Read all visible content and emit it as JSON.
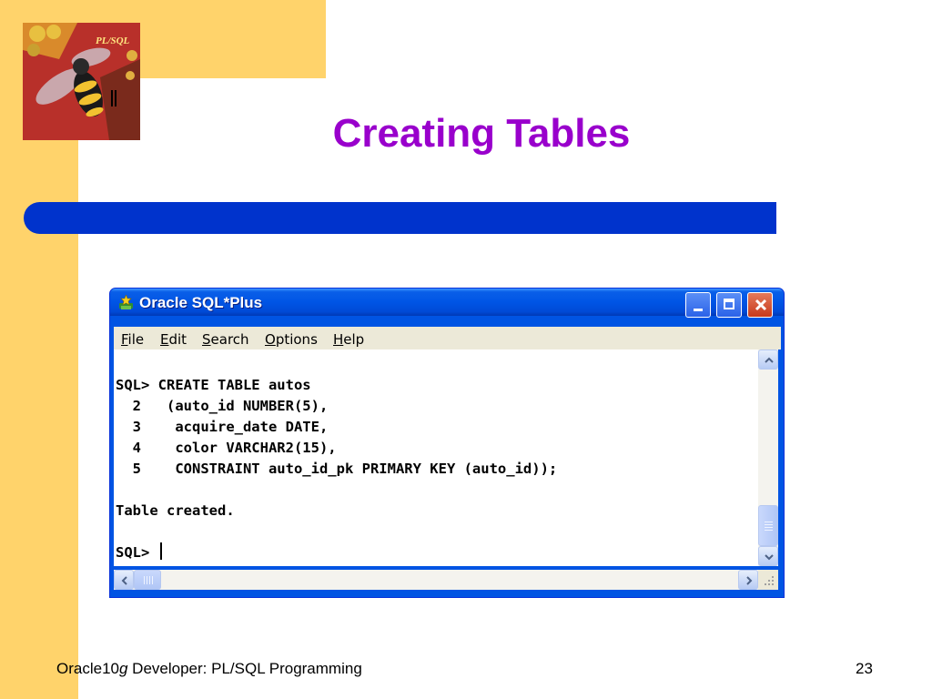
{
  "slide": {
    "title": "Creating Tables",
    "logo_text": "PL/SQL",
    "footer": {
      "product": "Oracle10",
      "product_suffix": "g",
      "rest": " Developer: PL/SQL Programming",
      "page_number": "23"
    }
  },
  "window": {
    "title": "Oracle SQL*Plus",
    "controls": [
      "minimize",
      "maximize",
      "close"
    ],
    "menu": [
      "File",
      "Edit",
      "Search",
      "Options",
      "Help"
    ],
    "console_lines": [
      "SQL> CREATE TABLE autos",
      "  2   (auto_id NUMBER(5),",
      "  3    acquire_date DATE,",
      "  4    color VARCHAR2(15),",
      "  5    CONSTRAINT auto_id_pk PRIMARY KEY (auto_id));",
      "",
      "Table created.",
      ""
    ],
    "prompt": "SQL> ",
    "scroll_position": 1.0
  },
  "icons": {
    "app": "oracle-sqlplus-icon",
    "scroll_up": "chevron-up-icon",
    "scroll_down": "chevron-down-icon",
    "scroll_left": "chevron-left-icon",
    "scroll_right": "chevron-right-icon"
  },
  "colors": {
    "accent_band": "#ffd36b",
    "title": "#9900cc",
    "blue_bar": "#0033cc",
    "xp_titlebar": "#0055e5"
  }
}
